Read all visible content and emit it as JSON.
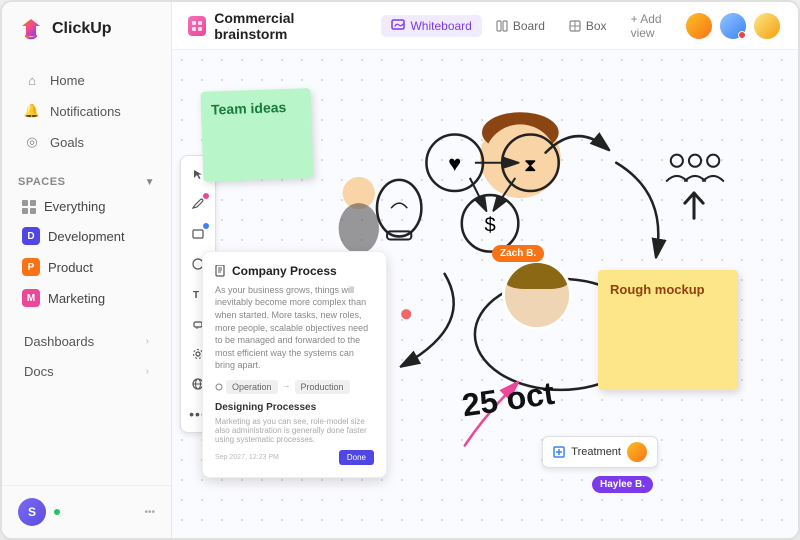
{
  "app": {
    "name": "ClickUp"
  },
  "sidebar": {
    "logo_text": "ClickUp",
    "nav_items": [
      {
        "label": "Home",
        "icon": "home"
      },
      {
        "label": "Notifications",
        "icon": "bell"
      },
      {
        "label": "Goals",
        "icon": "target"
      }
    ],
    "spaces_label": "Spaces",
    "spaces": [
      {
        "label": "Everything",
        "icon": "grid",
        "color": null
      },
      {
        "label": "Development",
        "icon": "D",
        "color": "#4f46e5"
      },
      {
        "label": "Product",
        "icon": "P",
        "color": "#f97316"
      },
      {
        "label": "Marketing",
        "icon": "M",
        "color": "#ec4899"
      }
    ],
    "bottom_nav": [
      {
        "label": "Dashboards"
      },
      {
        "label": "Docs"
      }
    ],
    "user_initial": "S"
  },
  "topbar": {
    "board_name": "Commercial brainstorm",
    "views": [
      {
        "label": "Whiteboard",
        "active": true
      },
      {
        "label": "Board",
        "active": false
      },
      {
        "label": "Box",
        "active": false
      }
    ],
    "add_view_label": "+ Add view"
  },
  "canvas": {
    "sticky_green_text": "Team ideas",
    "sticky_yellow_text": "Rough mockup",
    "process_card": {
      "title": "Company Process",
      "body": "As your business grows, things will inevitably become more complex than when started. More tasks, new roles, more people, scalable objectives need to be managed and forwarded to the most efficient way the systems can bring apart.",
      "tag1": "Operation",
      "tag2": "Production",
      "subtitle": "Designing Processes",
      "footer_text": "Marketing as you can see, role-model size also administration is generally done faster using systematic processes.",
      "progress_label": "Done",
      "date": "Sep 2027, 12:23 PM"
    },
    "name_badge": "Zach B.",
    "treatment_label": "Treatment",
    "haylee_badge": "Haylee B.",
    "oct_text": "25 oct",
    "avatars": [
      "A1",
      "A2",
      "A3"
    ]
  },
  "tools": [
    "cursor",
    "pen",
    "square",
    "circle",
    "text",
    "eraser",
    "settings",
    "globe",
    "dots"
  ]
}
